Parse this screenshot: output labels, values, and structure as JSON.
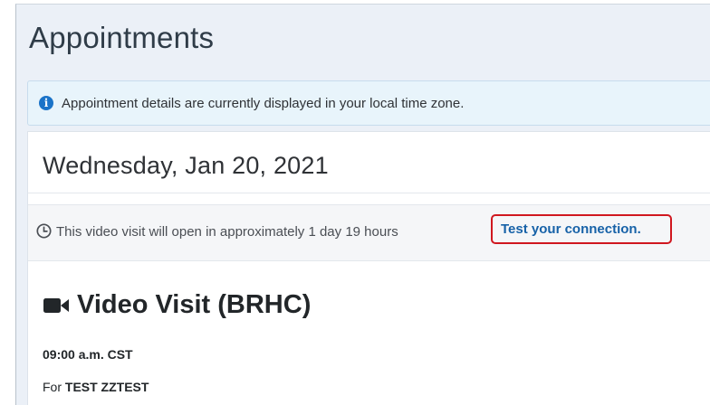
{
  "page": {
    "title": "Appointments"
  },
  "info_banner": {
    "icon": "info-icon",
    "text": "Appointment details are currently displayed in your local time zone."
  },
  "appointment": {
    "date_heading": "Wednesday, Jan 20, 2021",
    "notice": {
      "icon": "clock-icon",
      "text": "This video visit will open in approximately 1 day 19 hours",
      "link_label": "Test your connection.",
      "link_highlight_color": "#d0171f"
    },
    "visit": {
      "icon": "video-camera-icon",
      "title": "Video Visit (BRHC)",
      "time": "09:00 a.m. CST",
      "for_label": "For",
      "patient_name": "TEST ZZTEST"
    }
  },
  "colors": {
    "accent_link": "#1762a8",
    "info_icon": "#1a73c8",
    "page_background": "#ebf0f7"
  }
}
